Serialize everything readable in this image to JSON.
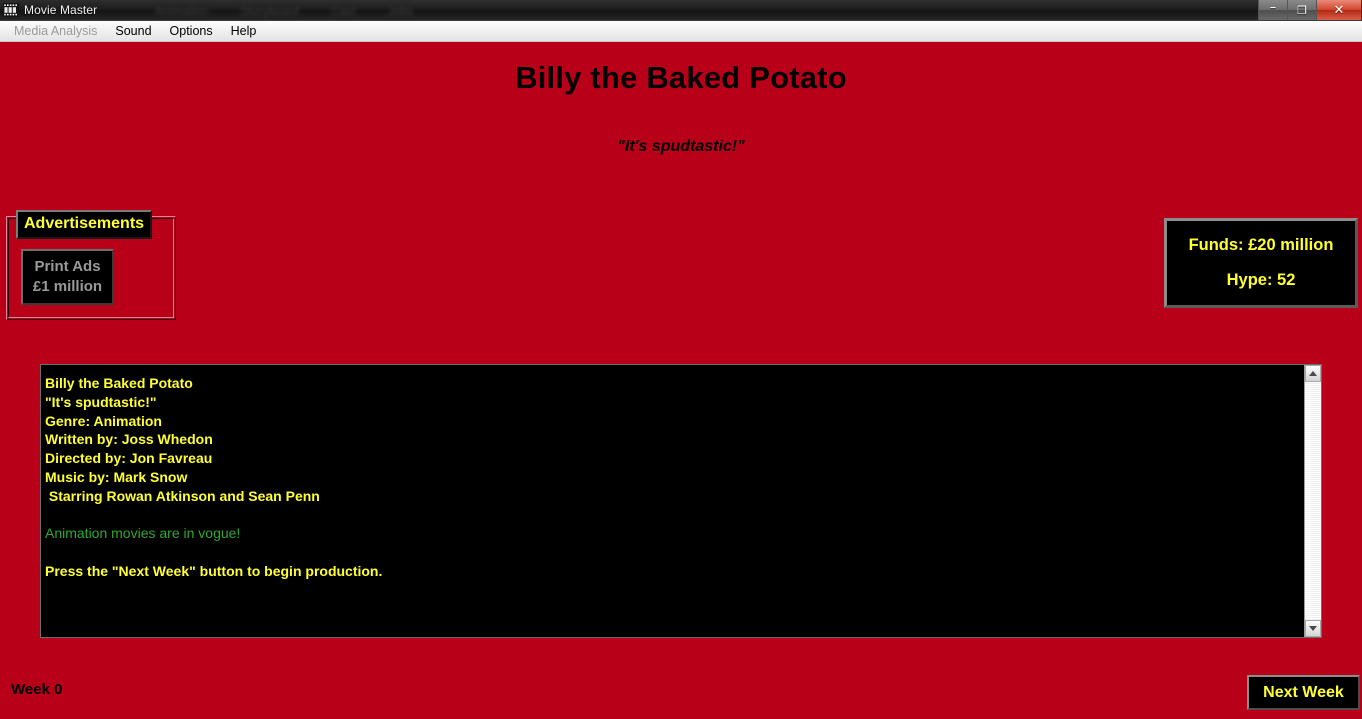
{
  "window": {
    "title": "Movie Master",
    "icon": "film-strip-icon",
    "ghost_labels": [
      "Animation",
      "Storyboard",
      "Cast",
      "Jobs"
    ],
    "controls": [
      {
        "name": "minimize-button",
        "glyph": "–"
      },
      {
        "name": "restore-button",
        "glyph": "❐"
      },
      {
        "name": "close-button",
        "glyph": "✕"
      }
    ]
  },
  "menubar": {
    "items": [
      {
        "label": "Media Analysis",
        "disabled": true
      },
      {
        "label": "Sound",
        "disabled": false
      },
      {
        "label": "Options",
        "disabled": false
      },
      {
        "label": "Help",
        "disabled": false
      }
    ]
  },
  "movie": {
    "title": "Billy the Baked Potato",
    "tagline": "\"It's spudtastic!\""
  },
  "advertisements": {
    "legend": "Advertisements",
    "buttons": [
      {
        "name": "print-ads-button",
        "line1": "Print Ads",
        "line2": "£1 million"
      }
    ]
  },
  "stats": {
    "funds": "Funds: £20 million",
    "hype": "Hype: 52"
  },
  "log": {
    "lines": [
      {
        "text": "Billy the Baked Potato",
        "style": "yellow"
      },
      {
        "text": "\"It's spudtastic!\"",
        "style": "yellow"
      },
      {
        "text": "Genre: Animation",
        "style": "yellow"
      },
      {
        "text": "Written by: Joss Whedon",
        "style": "yellow"
      },
      {
        "text": "Directed by: Jon Favreau",
        "style": "yellow"
      },
      {
        "text": "Music by: Mark Snow",
        "style": "yellow"
      },
      {
        "text": " Starring Rowan Atkinson and Sean Penn",
        "style": "yellow"
      },
      {
        "text": "",
        "style": "blank"
      },
      {
        "text": "Animation movies are in vogue!",
        "style": "green"
      },
      {
        "text": "",
        "style": "blank"
      },
      {
        "text": "Press the \"Next Week\" button to begin production.",
        "style": "yellow"
      }
    ]
  },
  "footer": {
    "week": "Week 0",
    "next_week_button": "Next Week"
  },
  "colors": {
    "background_red": "#b90019",
    "panel_black": "#000000",
    "accent_yellow": "#ffff33",
    "vogue_green": "#2ea82e",
    "disabled_grey": "#9a9a9a"
  }
}
